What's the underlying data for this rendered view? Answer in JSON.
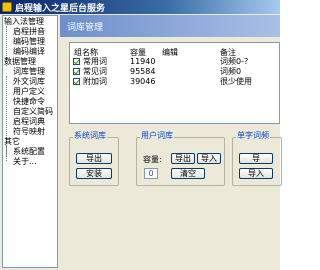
{
  "window": {
    "title": "启程输入之星后台服务"
  },
  "sidebar": {
    "items": [
      {
        "label": "输入法管理"
      },
      {
        "label": "启程拼音"
      },
      {
        "label": "编码管理"
      },
      {
        "label": "编码编译"
      },
      {
        "label": "数据管理"
      },
      {
        "label": "词库管理"
      },
      {
        "label": "外文词库"
      },
      {
        "label": "用户定义"
      },
      {
        "label": "快捷命令"
      },
      {
        "label": "自定义简码"
      },
      {
        "label": "启程词典"
      },
      {
        "label": "符号映射"
      },
      {
        "label": "其它"
      },
      {
        "label": "系统配置"
      },
      {
        "label": "关于..."
      }
    ]
  },
  "main": {
    "header": "词库管理",
    "columns": [
      "组名称",
      "容量",
      "编辑",
      "备注"
    ],
    "rows": [
      {
        "name": "常用词",
        "capacity": "11940",
        "edit": "",
        "note": "词频0-?"
      },
      {
        "name": "常见词",
        "capacity": "95584",
        "edit": "",
        "note": "词频0"
      },
      {
        "name": "附加词",
        "capacity": "39046",
        "edit": "",
        "note": "很少使用"
      }
    ],
    "system_group": {
      "title": "系统词库",
      "export": "导出",
      "install": "安装"
    },
    "user_group": {
      "title": "用户词库",
      "capacity_label": "容量:",
      "capacity_value": "0",
      "export": "导出",
      "import": "导入",
      "clear": "清空"
    },
    "single_group": {
      "title": "单字词频",
      "export": "导",
      "import": "导入"
    }
  }
}
